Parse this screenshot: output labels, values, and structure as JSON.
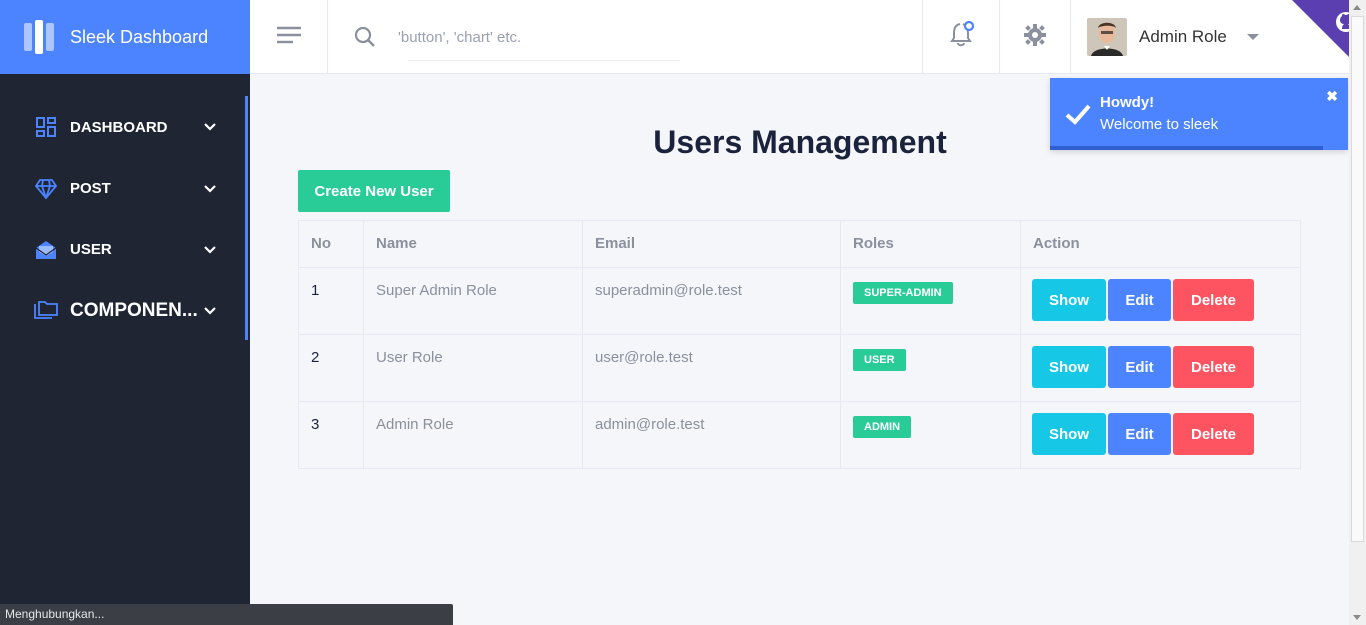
{
  "brand": {
    "name": "Sleek Dashboard"
  },
  "sidebar": {
    "items": [
      {
        "label": "DASHBOARD",
        "icon": "dashboard-icon"
      },
      {
        "label": "POST",
        "icon": "diamond-icon"
      },
      {
        "label": "USER",
        "icon": "email-open-icon"
      },
      {
        "label": "COMPONEN...",
        "icon": "folders-icon"
      }
    ]
  },
  "header": {
    "search_placeholder": "'button', 'chart' etc.",
    "user_name": "Admin Role"
  },
  "main": {
    "title": "Users Management",
    "create_label": "Create New User",
    "table": {
      "headers": [
        "No",
        "Name",
        "Email",
        "Roles",
        "Action"
      ],
      "rows": [
        {
          "no": "1",
          "name": "Super Admin Role",
          "email": "superadmin@role.test",
          "role": "SUPER-ADMIN"
        },
        {
          "no": "2",
          "name": "User Role",
          "email": "user@role.test",
          "role": "USER"
        },
        {
          "no": "3",
          "name": "Admin Role",
          "email": "admin@role.test",
          "role": "ADMIN"
        }
      ],
      "actions": {
        "show": "Show",
        "edit": "Edit",
        "delete": "Delete"
      }
    }
  },
  "toast": {
    "title": "Howdy!",
    "message": "Welcome to sleek",
    "close": "✖"
  },
  "status_bar": {
    "text": "Menghubungkan..."
  },
  "colors": {
    "primary": "#4c84ff",
    "success": "#29cc97",
    "info": "#17c7e6",
    "danger": "#fe5461",
    "sidebar": "#1f2533",
    "github_corner": "#5b3fb0"
  }
}
